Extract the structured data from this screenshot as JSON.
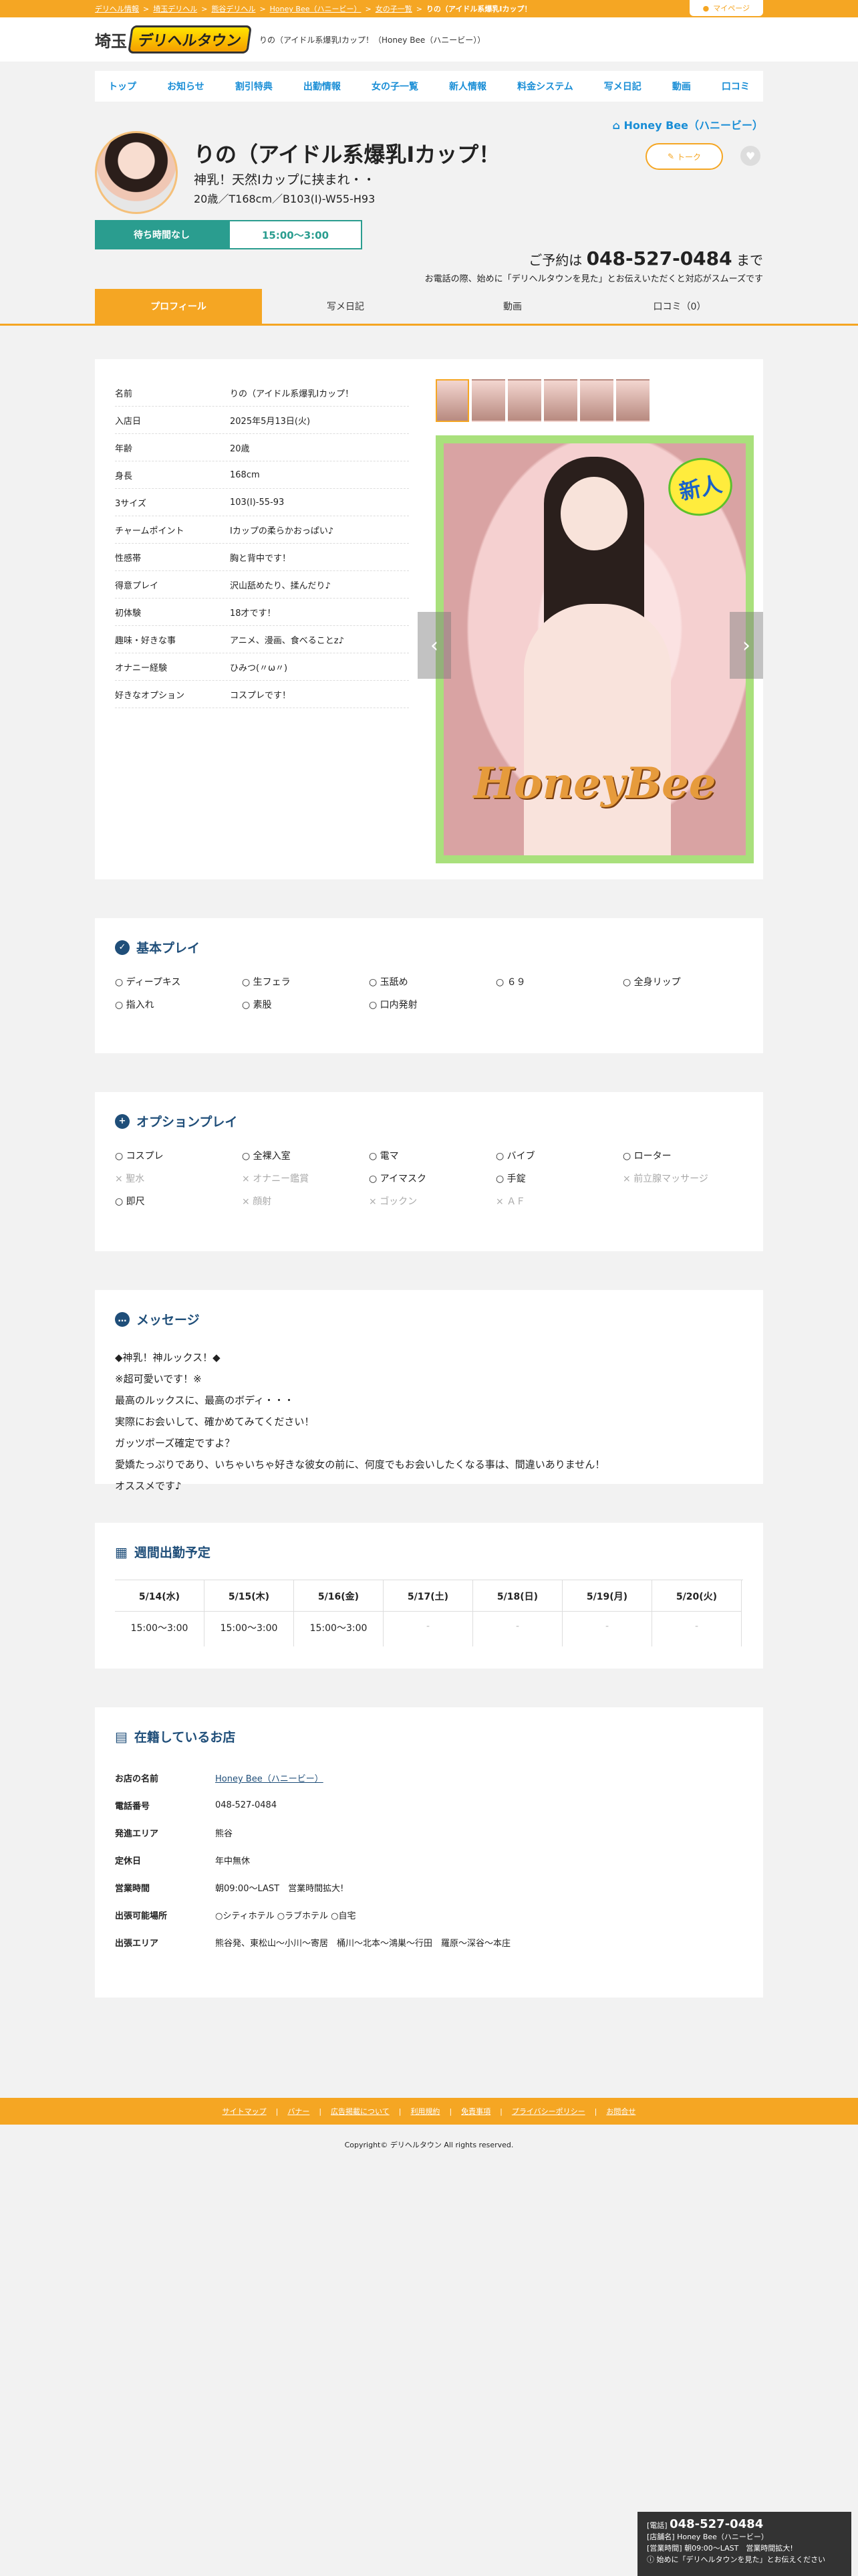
{
  "breadcrumb": {
    "items": [
      "デリヘル情報",
      "埼玉デリヘル",
      "熊谷デリヘル",
      "Honey Bee（ハニービー）",
      "女の子一覧",
      "りの（アイドル系爆乳Iカップ！"
    ],
    "sep": ">",
    "mypage": "マイページ"
  },
  "header": {
    "logo_pref": "埼玉",
    "logo_mark": "デリヘルタウン",
    "title": "りの（アイドル系爆乳Iカップ！（Honey Bee（ハニービー））"
  },
  "nav": [
    "トップ",
    "お知らせ",
    "割引特典",
    "出勤情報",
    "女の子一覧",
    "新人情報",
    "料金システム",
    "写メ日記",
    "動画",
    "口コミ"
  ],
  "profile_head": {
    "shop": "Honey Bee（ハニービー）",
    "name": "りの（アイドル系爆乳Iカップ！",
    "catch": "神乳！天然Iカップに挟まれ・・",
    "spec": "20歳／T168cm／B103(I)-W55-H93",
    "talk": "トーク",
    "wait_label": "待ち時間なし",
    "wait_time": "15:00〜3:00",
    "reserve_prefix": "ご予約は",
    "reserve_tel": "048-527-0484",
    "reserve_suffix": "まで",
    "reserve_note": "お電話の際、始めに「デリヘルタウンを見た」とお伝えいただくと対応がスムーズです"
  },
  "tabs": [
    "プロフィール",
    "写メ日記",
    "動画",
    "口コミ（0）"
  ],
  "profile": [
    {
      "k": "名前",
      "v": "りの（アイドル系爆乳Iカップ！"
    },
    {
      "k": "入店日",
      "v": "2025年5月13日(火)"
    },
    {
      "k": "年齢",
      "v": "20歳"
    },
    {
      "k": "身長",
      "v": "168cm"
    },
    {
      "k": "3サイズ",
      "v": "103(I)-55-93"
    },
    {
      "k": "チャームポイント",
      "v": "Iカップの柔らかおっぱい♪"
    },
    {
      "k": "性感帯",
      "v": "胸と背中です！"
    },
    {
      "k": "得意プレイ",
      "v": "沢山舐めたり、揉んだり♪"
    },
    {
      "k": "初体験",
      "v": "18才です！"
    },
    {
      "k": "趣味・好きな事",
      "v": "アニメ、漫画、食べることz♪"
    },
    {
      "k": "オナニー経験",
      "v": "ひみつ(〃ω〃)"
    },
    {
      "k": "好きなオプション",
      "v": "コスプレです！"
    }
  ],
  "photo": {
    "new_badge": "新人",
    "logo": "HoneyBee",
    "prev": "‹",
    "next": "›"
  },
  "basic": {
    "title": "基本プレイ",
    "items": [
      {
        "t": "ディープキス",
        "ok": true
      },
      {
        "t": "生フェラ",
        "ok": true
      },
      {
        "t": "玉舐め",
        "ok": true
      },
      {
        "t": "６９",
        "ok": true
      },
      {
        "t": "全身リップ",
        "ok": true
      },
      {
        "t": "指入れ",
        "ok": true
      },
      {
        "t": "素股",
        "ok": true
      },
      {
        "t": "口内発射",
        "ok": true
      }
    ]
  },
  "option": {
    "title": "オプションプレイ",
    "items": [
      {
        "t": "コスプレ",
        "ok": true
      },
      {
        "t": "全裸入室",
        "ok": true
      },
      {
        "t": "電マ",
        "ok": true
      },
      {
        "t": "バイブ",
        "ok": true
      },
      {
        "t": "ローター",
        "ok": true
      },
      {
        "t": "聖水",
        "ok": false
      },
      {
        "t": "オナニー鑑賞",
        "ok": false
      },
      {
        "t": "アイマスク",
        "ok": true
      },
      {
        "t": "手錠",
        "ok": true
      },
      {
        "t": "前立腺マッサージ",
        "ok": false
      },
      {
        "t": "即尺",
        "ok": true
      },
      {
        "t": "顔射",
        "ok": false
      },
      {
        "t": "ゴックン",
        "ok": false
      },
      {
        "t": "ＡＦ",
        "ok": false
      }
    ]
  },
  "message": {
    "title": "メッセージ",
    "lines": [
      "◆神乳！神ルックス！◆",
      "※超可愛いです！※",
      "最高のルックスに、最高のボディ・・・",
      "実際にお会いして、確かめてみてください！",
      "ガッツポーズ確定ですよ？",
      "愛嬌たっぷりであり、いちゃいちゃ好きな彼女の前に、何度でもお会いしたくなる事は、間違いありません！",
      "オススメです♪"
    ]
  },
  "week": {
    "title": "週間出勤予定",
    "days": [
      {
        "d": "5/14(水)",
        "t": "15:00〜3:00"
      },
      {
        "d": "5/15(木)",
        "t": "15:00〜3:00"
      },
      {
        "d": "5/16(金)",
        "t": "15:00〜3:00"
      },
      {
        "d": "5/17(土)",
        "t": "-"
      },
      {
        "d": "5/18(日)",
        "t": "-"
      },
      {
        "d": "5/19(月)",
        "t": "-"
      },
      {
        "d": "5/20(火)",
        "t": "-"
      }
    ]
  },
  "shop": {
    "title": "在籍しているお店",
    "rows": [
      {
        "k": "お店の名前",
        "v": "Honey Bee（ハニービー）",
        "link": true
      },
      {
        "k": "電話番号",
        "v": "048-527-0484"
      },
      {
        "k": "発進エリア",
        "v": "熊谷"
      },
      {
        "k": "定休日",
        "v": "年中無休"
      },
      {
        "k": "営業時間",
        "v": "朝09:00〜LAST　営業時間拡大!"
      },
      {
        "k": "出張可能場所",
        "v": "○シティホテル ○ラブホテル ○自宅"
      },
      {
        "k": "出張エリア",
        "v": "熊谷発、東松山〜小川〜寄居　桶川〜北本〜鴻巣〜行田　羅原〜深谷〜本庄"
      }
    ]
  },
  "footer": {
    "links": [
      "サイトマップ",
      "バナー",
      "広告掲載について",
      "利用規約",
      "免責事項",
      "プライバシーポリシー",
      "お問合せ"
    ],
    "sep": "|",
    "copyright": "Copyright© デリヘルタウン All rights reserved."
  },
  "floatbox": {
    "tel_label": "[電話]",
    "tel": "048-527-0484",
    "shop_line": "[店舗名] Honey Bee（ハニービー）",
    "hours_line": "[営業時間] 朝09:00〜LAST　営業時間拡大!",
    "note": "始めに「デリヘルタウンを見た」とお伝えください"
  },
  "colors": {
    "accent": "#f5a623",
    "teal": "#2a9d8f",
    "navy": "#1f4e79",
    "link": "#1a8ed6"
  }
}
